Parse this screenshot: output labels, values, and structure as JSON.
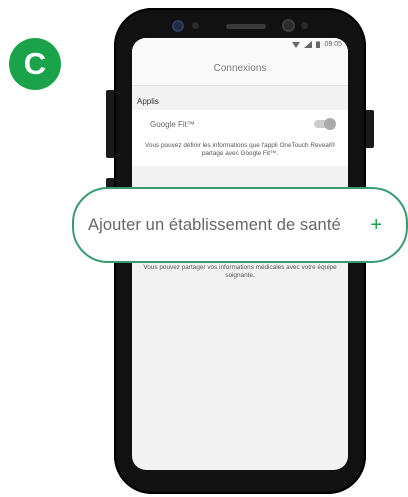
{
  "step_badge": "C",
  "status_bar": {
    "time": "09:05"
  },
  "app": {
    "title": "Connexions"
  },
  "section": {
    "title": "Applis"
  },
  "google_fit": {
    "label": "Google Fit™",
    "toggle_on": true,
    "description": "Vous pouvez définir les informations que l'appli OneTouch Reveal® partage avec Google Fit™."
  },
  "add_provider": {
    "label": "Ajouter un établissement de santé",
    "icon": "plus-icon",
    "symbol": "+"
  },
  "share_text": "Vous pouvez partager vos informations médicales avec votre équipe soignante.",
  "colors": {
    "accent": "#1aa34a",
    "callout_border": "#3a9b70"
  }
}
